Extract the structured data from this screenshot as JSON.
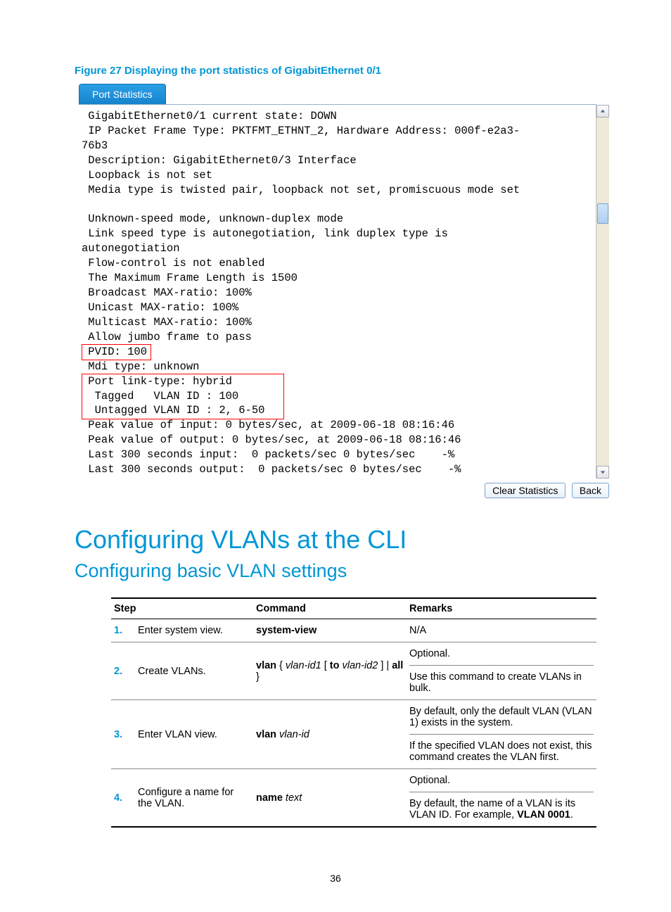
{
  "figure": {
    "caption": "Figure 27 Displaying the port statistics of GigabitEthernet 0/1",
    "tab_label": "Port Statistics"
  },
  "terminal_lines": [
    " GigabitEthernet0/1 current state: DOWN",
    " IP Packet Frame Type: PKTFMT_ETHNT_2, Hardware Address: 000f-e2a3-",
    "76b3",
    " Description: GigabitEthernet0/3 Interface",
    " Loopback is not set",
    " Media type is twisted pair, loopback not set, promiscuous mode set",
    "",
    " Unknown-speed mode, unknown-duplex mode",
    " Link speed type is autonegotiation, link duplex type is",
    "autonegotiation",
    " Flow-control is not enabled",
    " The Maximum Frame Length is 1500",
    " Broadcast MAX-ratio: 100%",
    " Unicast MAX-ratio: 100%",
    " Multicast MAX-ratio: 100%",
    " Allow jumbo frame to pass",
    " PVID: 100",
    " Mdi type: unknown",
    " Port link-type: hybrid",
    "  Tagged   VLAN ID : 100",
    "  Untagged VLAN ID : 2, 6-50",
    " Peak value of input: 0 bytes/sec, at 2009-06-18 08:16:46",
    " Peak value of output: 0 bytes/sec, at 2009-06-18 08:16:46",
    " Last 300 seconds input:  0 packets/sec 0 bytes/sec    -%",
    " Last 300 seconds output:  0 packets/sec 0 bytes/sec    -%"
  ],
  "buttons": {
    "clear": "Clear Statistics",
    "back": "Back"
  },
  "h1": "Configuring VLANs at the CLI",
  "h2": "Configuring basic VLAN settings",
  "table": {
    "headers": {
      "step": "Step",
      "command": "Command",
      "remarks": "Remarks"
    },
    "rows": [
      {
        "num": "1.",
        "step": "Enter system view.",
        "cmd_bold": "system-view",
        "remarks_a": "N/A"
      },
      {
        "num": "2.",
        "step": "Create VLANs.",
        "cmd_pre_b": "vlan",
        "cmd_i1": "vlan-id1",
        "cmd_mid_b": "to",
        "cmd_i2": "vlan-id2",
        "cmd_post_b": "all",
        "remarks_a": "Optional.",
        "remarks_b": "Use this command to create VLANs in bulk."
      },
      {
        "num": "3.",
        "step": "Enter VLAN view.",
        "cmd_b": "vlan",
        "cmd_i": "vlan-id",
        "remarks_a": "By default, only the default VLAN (VLAN 1) exists in the system.",
        "remarks_b": "If the specified VLAN does not exist, this command creates the VLAN first."
      },
      {
        "num": "4.",
        "step": "Configure a name for the VLAN.",
        "cmd_b": "name",
        "cmd_i": "text",
        "remarks_a": "Optional.",
        "remarks_b_pre": "By default, the name of a VLAN is its VLAN ID. For example, ",
        "remarks_b_bold": "VLAN 0001",
        "remarks_b_post": "."
      }
    ]
  },
  "page_number": "36"
}
